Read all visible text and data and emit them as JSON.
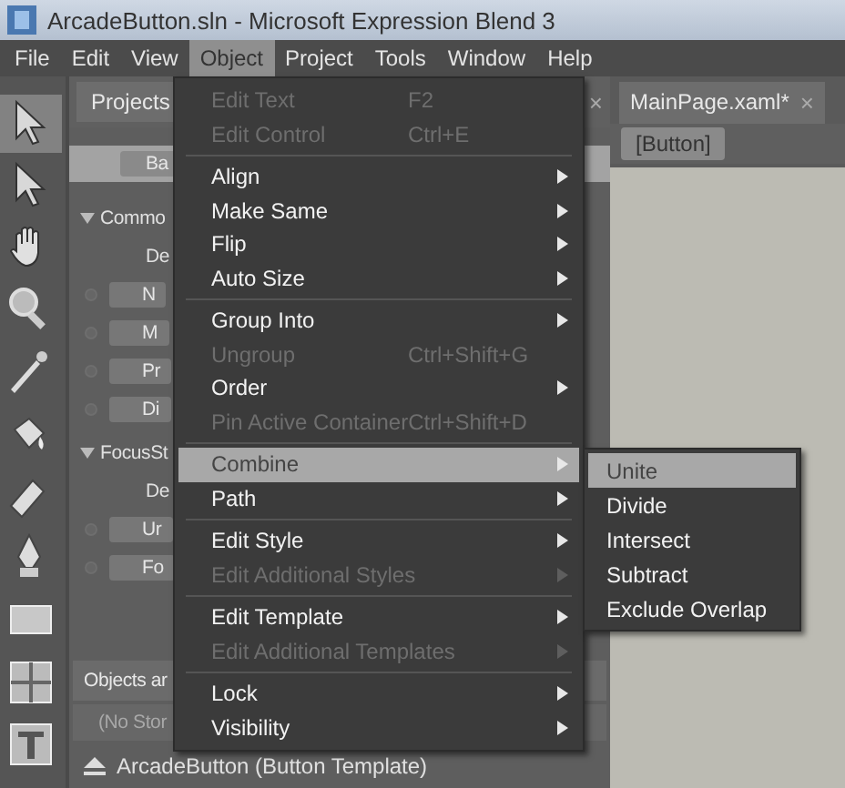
{
  "window": {
    "title": "ArcadeButton.sln - Microsoft Expression Blend 3"
  },
  "menu_bar": [
    {
      "label": "File",
      "selected": false
    },
    {
      "label": "Edit",
      "selected": false
    },
    {
      "label": "View",
      "selected": false
    },
    {
      "label": "Object",
      "selected": true
    },
    {
      "label": "Project",
      "selected": false
    },
    {
      "label": "Tools",
      "selected": false
    },
    {
      "label": "Window",
      "selected": false
    },
    {
      "label": "Help",
      "selected": false
    }
  ],
  "tools": [
    {
      "kind": "select",
      "selected": true
    },
    {
      "kind": "direct-select",
      "selected": false
    },
    {
      "kind": "hand",
      "selected": false
    },
    {
      "kind": "zoom",
      "selected": false
    },
    {
      "kind": "eyedropper",
      "selected": false
    },
    {
      "kind": "bucket",
      "selected": false
    },
    {
      "kind": "eraser",
      "selected": false
    },
    {
      "kind": "pen",
      "selected": false
    },
    {
      "kind": "rectangle",
      "selected": false
    },
    {
      "kind": "grid",
      "selected": false
    },
    {
      "kind": "text",
      "selected": false
    }
  ],
  "states_panel": {
    "tab": "Projects",
    "close": "×",
    "base": "Ba",
    "groups": [
      {
        "name": "Commo",
        "expanded": true,
        "children": [
          {
            "kind": "default",
            "label": "De"
          },
          {
            "kind": "state",
            "label": "N"
          },
          {
            "kind": "state",
            "label": "M"
          },
          {
            "kind": "state",
            "label": "Pr"
          },
          {
            "kind": "state",
            "label": "Di"
          }
        ]
      },
      {
        "name": "FocusSt",
        "expanded": true,
        "children": [
          {
            "kind": "default",
            "label": "De"
          },
          {
            "kind": "state",
            "label": "Ur"
          },
          {
            "kind": "state",
            "label": "Fo"
          }
        ]
      }
    ]
  },
  "objects_panel": {
    "title": "Objects ar",
    "storyboard": "(No Stor",
    "scope": "ArcadeButton (Button Template)"
  },
  "document": {
    "tab": "MainPage.xaml*",
    "close": "×",
    "breadcrumb": "[Button]"
  },
  "object_menu": [
    {
      "kind": "item",
      "label": "Edit Text",
      "shortcut": "F2",
      "disabled": true,
      "submenu": false,
      "selected": false
    },
    {
      "kind": "item",
      "label": "Edit Control",
      "shortcut": "Ctrl+E",
      "disabled": true,
      "submenu": false,
      "selected": false
    },
    {
      "kind": "separator"
    },
    {
      "kind": "item",
      "label": "Align",
      "disabled": false,
      "submenu": true,
      "selected": false
    },
    {
      "kind": "item",
      "label": "Make Same",
      "disabled": false,
      "submenu": true,
      "selected": false
    },
    {
      "kind": "item",
      "label": "Flip",
      "disabled": false,
      "submenu": true,
      "selected": false
    },
    {
      "kind": "item",
      "label": "Auto Size",
      "disabled": false,
      "submenu": true,
      "selected": false
    },
    {
      "kind": "separator"
    },
    {
      "kind": "item",
      "label": "Group Into",
      "disabled": false,
      "submenu": true,
      "selected": false
    },
    {
      "kind": "item",
      "label": "Ungroup",
      "shortcut": "Ctrl+Shift+G",
      "disabled": true,
      "submenu": false,
      "selected": false
    },
    {
      "kind": "item",
      "label": "Order",
      "disabled": false,
      "submenu": true,
      "selected": false
    },
    {
      "kind": "item",
      "label": "Pin Active Container",
      "shortcut": "Ctrl+Shift+D",
      "disabled": true,
      "submenu": false,
      "selected": false
    },
    {
      "kind": "separator"
    },
    {
      "kind": "item",
      "label": "Combine",
      "disabled": false,
      "submenu": true,
      "selected": true
    },
    {
      "kind": "item",
      "label": "Path",
      "disabled": false,
      "submenu": true,
      "selected": false
    },
    {
      "kind": "separator"
    },
    {
      "kind": "item",
      "label": "Edit Style",
      "disabled": false,
      "submenu": true,
      "selected": false
    },
    {
      "kind": "item",
      "label": "Edit Additional Styles",
      "disabled": true,
      "submenu": true,
      "selected": false
    },
    {
      "kind": "separator"
    },
    {
      "kind": "item",
      "label": "Edit Template",
      "disabled": false,
      "submenu": true,
      "selected": false
    },
    {
      "kind": "item",
      "label": "Edit Additional Templates",
      "disabled": true,
      "submenu": true,
      "selected": false
    },
    {
      "kind": "separator"
    },
    {
      "kind": "item",
      "label": "Lock",
      "disabled": false,
      "submenu": true,
      "selected": false
    },
    {
      "kind": "item",
      "label": "Visibility",
      "disabled": false,
      "submenu": true,
      "selected": false
    }
  ],
  "combine_submenu": [
    {
      "label": "Unite",
      "selected": true
    },
    {
      "label": "Divide",
      "selected": false
    },
    {
      "label": "Intersect",
      "selected": false
    },
    {
      "label": "Subtract",
      "selected": false
    },
    {
      "label": "Exclude Overlap",
      "selected": false
    }
  ]
}
